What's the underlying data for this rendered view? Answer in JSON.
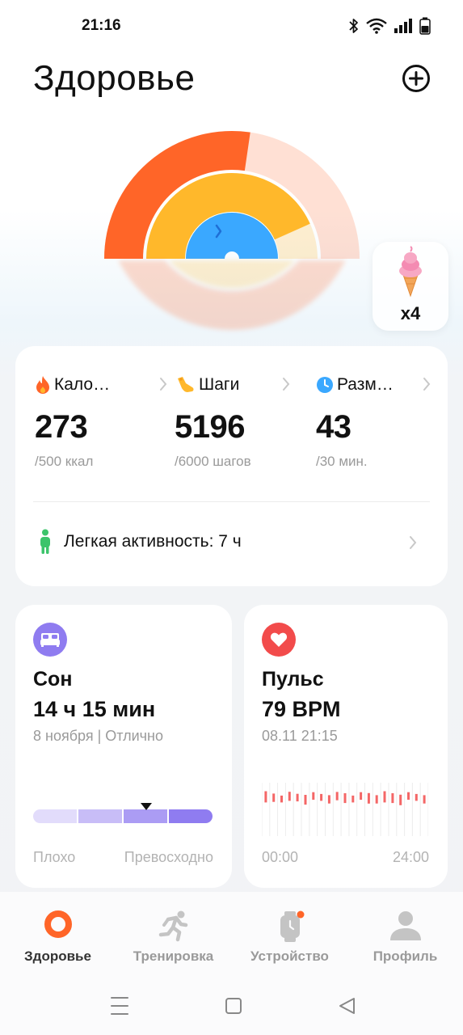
{
  "status_bar": {
    "time": "21:16"
  },
  "header": {
    "title": "Здоровье"
  },
  "rings": {
    "calories_fraction": 0.546,
    "steps_fraction": 0.866,
    "workout_fraction": 1.0,
    "colors": {
      "calories": "#ff6528",
      "steps": "#ffb82b",
      "workout": "#3aa8ff"
    }
  },
  "reward": {
    "count": "x4"
  },
  "metrics": [
    {
      "label": "Кало…",
      "value": "273",
      "goal": "/500 ккал",
      "icon": "flame-icon"
    },
    {
      "label": "Шаги",
      "value": "5196",
      "goal": "/6000 шагов",
      "icon": "shoe-icon"
    },
    {
      "label": "Разм…",
      "value": "43",
      "goal": "/30 мин.",
      "icon": "clock-icon"
    }
  ],
  "light_activity": {
    "label": "Легкая активность: 7 ч",
    "icon": "person-icon"
  },
  "sleep": {
    "title": "Сон",
    "value": "14 ч 15 мин",
    "subtitle": "8 ноября | Отлично",
    "scale_left": "Плохо",
    "scale_right": "Превосходно",
    "rating_fraction": 0.63,
    "icon": "bed-icon",
    "accent": "#8f7cf0"
  },
  "pulse": {
    "title": "Пульс",
    "value": "79 BPM",
    "subtitle": "08.11 21:15",
    "axis_start": "00:00",
    "axis_end": "24:00",
    "icon": "heart-icon",
    "accent": "#f24b4b",
    "bars": [
      0.55,
      0.35,
      0.25,
      0.4,
      0.3,
      0.45,
      0.3,
      0.25,
      0.35,
      0.35,
      0.45,
      0.25,
      0.3,
      0.5,
      0.35,
      0.55,
      0.45,
      0.5,
      0.3,
      0.25,
      0.35
    ]
  },
  "nav": [
    {
      "label": "Здоровье",
      "icon": "health-ring-icon",
      "active": true
    },
    {
      "label": "Тренировка",
      "icon": "running-icon",
      "active": false
    },
    {
      "label": "Устройство",
      "icon": "watch-icon",
      "active": false
    },
    {
      "label": "Профиль",
      "icon": "profile-icon",
      "active": false
    }
  ]
}
